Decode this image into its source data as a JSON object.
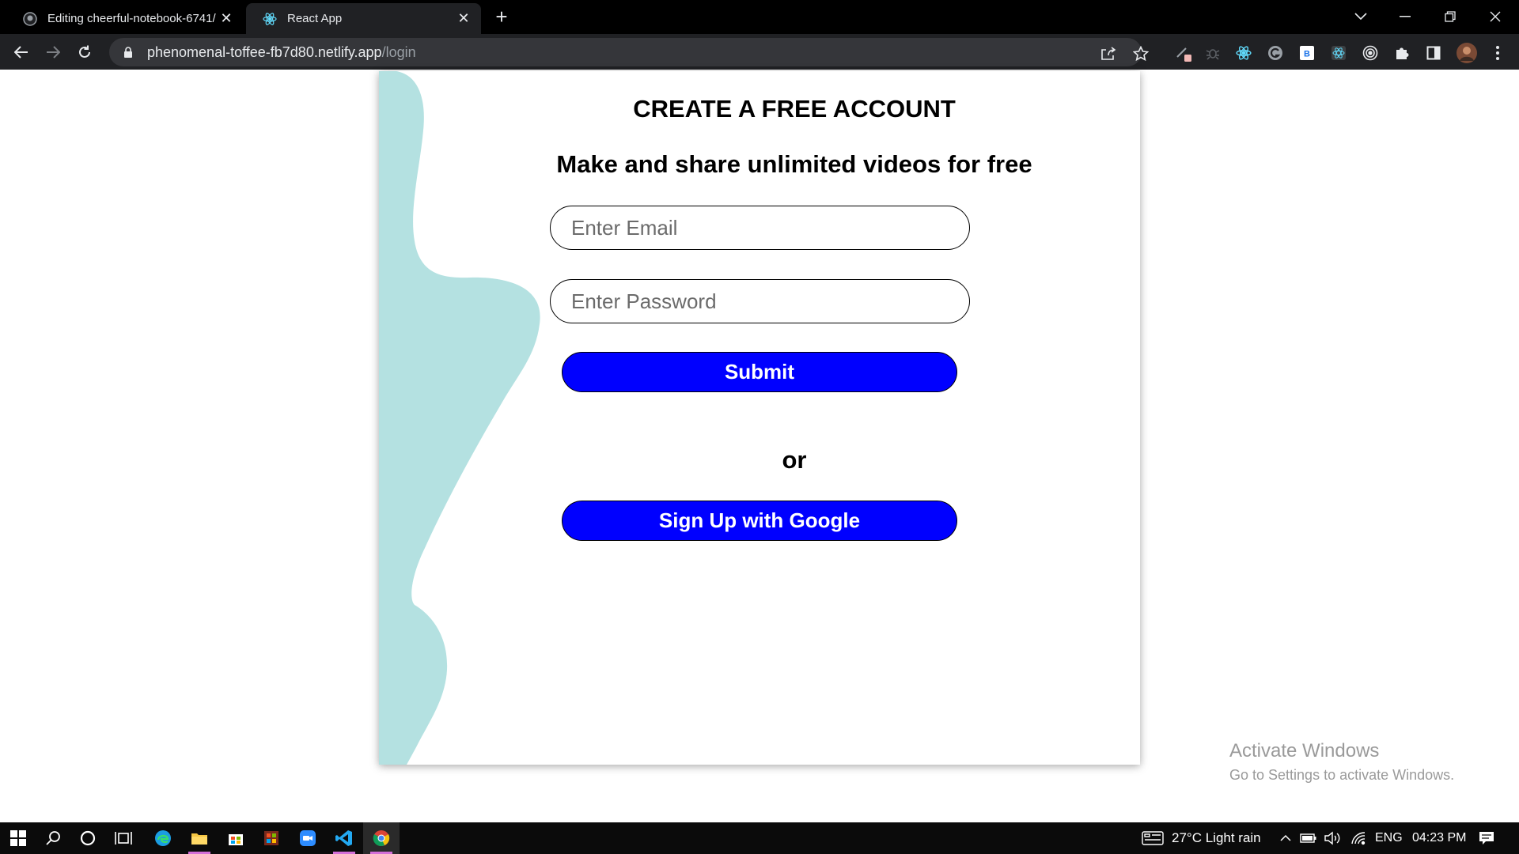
{
  "browser": {
    "tabs": [
      {
        "title": "Editing cheerful-notebook-6741/",
        "favicon": "github-icon",
        "active": false
      },
      {
        "title": "React App",
        "favicon": "react-icon",
        "active": true
      }
    ],
    "new_tab": "+",
    "address": {
      "host": "phenomenal-toffee-fb7d80.netlify.app",
      "path": "/login"
    }
  },
  "page": {
    "heading": "CREATE A FREE ACCOUNT",
    "subheading": "Make and share unlimited videos for free",
    "email_placeholder": "Enter Email",
    "password_placeholder": "Enter Password",
    "submit_label": "Submit",
    "or_text": "or",
    "google_label": "Sign Up with Google"
  },
  "watermark": {
    "line1": "Activate Windows",
    "line2": "Go to Settings to activate Windows."
  },
  "taskbar": {
    "weather": "27°C  Light rain",
    "language": "ENG",
    "time": "04:23 PM"
  },
  "colors": {
    "accent_button": "#0000ff",
    "blob": "#b4e1e1",
    "tab_bar": "#000000",
    "toolbar": "#202124",
    "taskbar": "#0b0b0b"
  }
}
